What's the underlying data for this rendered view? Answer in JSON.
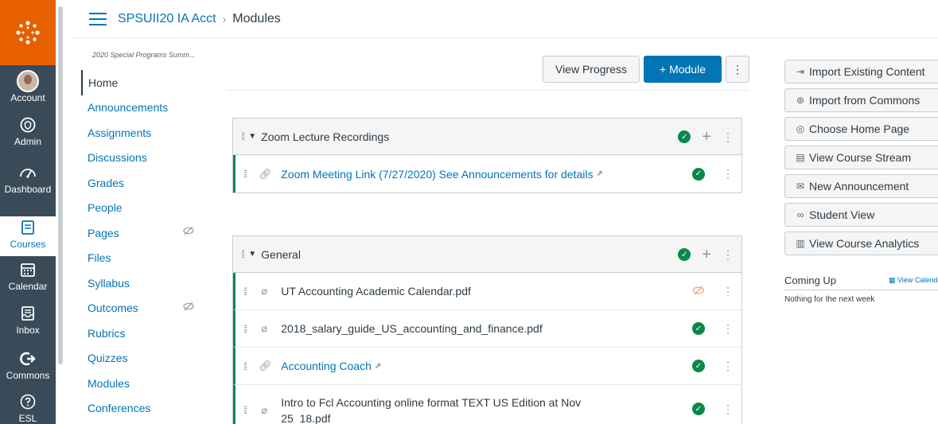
{
  "global_nav": {
    "items": [
      {
        "label": "Account",
        "icon": "user-avatar-icon"
      },
      {
        "label": "Admin",
        "icon": "shield-icon"
      },
      {
        "label": "Dashboard",
        "icon": "dashboard-icon"
      },
      {
        "label": "Courses",
        "icon": "book-icon"
      },
      {
        "label": "Calendar",
        "icon": "calendar-icon"
      },
      {
        "label": "Inbox",
        "icon": "inbox-icon"
      },
      {
        "label": "Commons",
        "icon": "commons-arrow-icon"
      },
      {
        "label": "ESL",
        "icon": "question-circle-icon"
      }
    ],
    "active": "Courses",
    "colors": {
      "logo_bg": "#e66000",
      "nav_bg": "#394b58"
    }
  },
  "header": {
    "course_link": "SPSUII20 IA Acct",
    "separator": "›",
    "current": "Modules"
  },
  "course_nav": {
    "term": "2020 Special Programs Summ...",
    "items": [
      {
        "label": "Home",
        "active": true
      },
      {
        "label": "Announcements"
      },
      {
        "label": "Assignments"
      },
      {
        "label": "Discussions"
      },
      {
        "label": "Grades"
      },
      {
        "label": "People"
      },
      {
        "label": "Pages",
        "hidden": true
      },
      {
        "label": "Files"
      },
      {
        "label": "Syllabus"
      },
      {
        "label": "Outcomes",
        "hidden": true
      },
      {
        "label": "Rubrics"
      },
      {
        "label": "Quizzes"
      },
      {
        "label": "Modules"
      },
      {
        "label": "Conferences"
      }
    ]
  },
  "toolbar": {
    "view_progress": "View Progress",
    "add_module": "+ Module",
    "more": "⋮"
  },
  "modules": [
    {
      "title": "Zoom Lecture Recordings",
      "items": [
        {
          "title": "Zoom Meeting Link (7/27/2020) See Announcements for details",
          "type": "link",
          "external": true,
          "status": "published"
        }
      ]
    },
    {
      "title": "General",
      "items": [
        {
          "title": "UT Accounting Academic Calendar.pdf",
          "type": "file",
          "status": "unpublished"
        },
        {
          "title": "2018_salary_guide_US_accounting_and_finance.pdf",
          "type": "file",
          "status": "published"
        },
        {
          "title": "Accounting Coach",
          "type": "link",
          "external": true,
          "status": "published"
        },
        {
          "title": "Intro to Fcl Accounting online format TEXT US Edition at Nov 25_18.pdf",
          "type": "file",
          "status": "published"
        }
      ]
    }
  ],
  "sidebar": {
    "buttons": [
      {
        "label": "Import Existing Content",
        "icon": "import-icon"
      },
      {
        "label": "Import from Commons",
        "icon": "commons-icon"
      },
      {
        "label": "Choose Home Page",
        "icon": "target-icon"
      },
      {
        "label": "View Course Stream",
        "icon": "stream-icon"
      },
      {
        "label": "New Announcement",
        "icon": "megaphone-icon"
      },
      {
        "label": "Student View",
        "icon": "glasses-icon"
      },
      {
        "label": "View Course Analytics",
        "icon": "analytics-icon"
      }
    ],
    "coming_up": {
      "title": "Coming Up",
      "link": "View Calendar",
      "empty": "Nothing for the next week"
    }
  }
}
